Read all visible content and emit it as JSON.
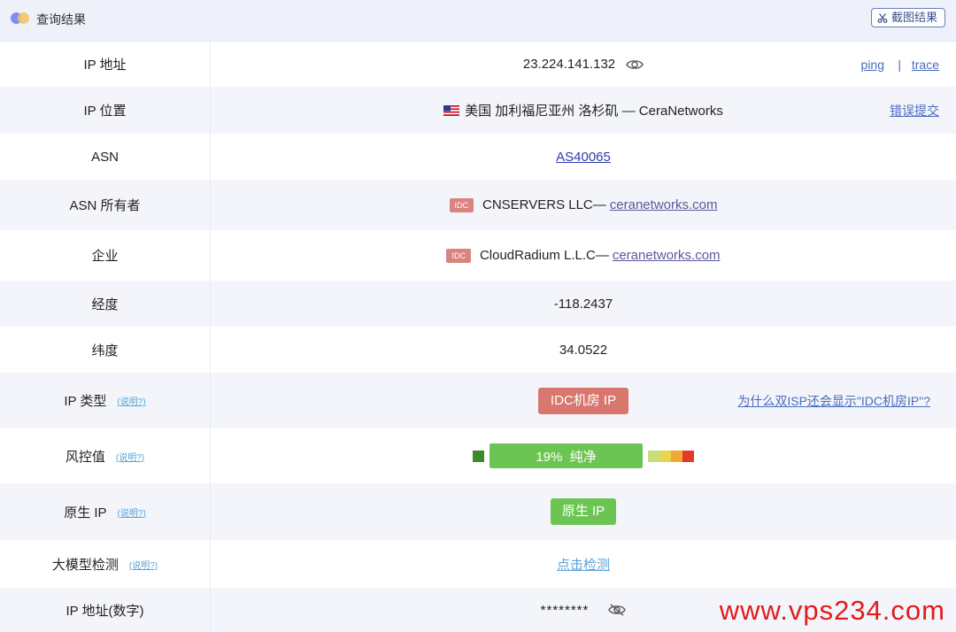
{
  "header": {
    "title": "查询结果",
    "screenshot_label": "截图结果"
  },
  "rows": {
    "ip": {
      "label": "IP 地址",
      "value": "23.224.141.132",
      "ping": "ping",
      "sep": "|",
      "trace": "trace"
    },
    "location": {
      "label": "IP 位置",
      "flag": "🇺🇸",
      "value": "美国 加利福尼亚州 洛杉矶 — CeraNetworks",
      "report": "错误提交"
    },
    "asn": {
      "label": "ASN",
      "value": "AS40065"
    },
    "asn_owner": {
      "label": "ASN 所有者",
      "badge": "IDC",
      "name": "CNSERVERS LLC—",
      "domain": "ceranetworks.com"
    },
    "company": {
      "label": "企业",
      "badge": "IDC",
      "name": "CloudRadium L.L.C—",
      "domain": "ceranetworks.com"
    },
    "longitude": {
      "label": "经度",
      "value": "-118.2437"
    },
    "latitude": {
      "label": "纬度",
      "value": "34.0522"
    },
    "ip_type": {
      "label": "IP 类型",
      "help": "(说明?)",
      "tag": "IDC机房 IP",
      "why": "为什么双ISP还会显示\"IDC机房IP\"?"
    },
    "risk": {
      "label": "风控值",
      "help": "(说明?)",
      "score_text": "19%  纯净",
      "score_percent": 19,
      "scale_colors": [
        "#c6df7a",
        "#e8d54e",
        "#eeaa35",
        "#e23a2a"
      ]
    },
    "native_ip": {
      "label": "原生 IP",
      "help": "(说明?)",
      "tag": "原生 IP"
    },
    "llm": {
      "label": "大模型检测",
      "help": "(说明?)",
      "link": "点击检测"
    },
    "ip_numeric": {
      "label": "IP 地址(数字)",
      "value": "********"
    }
  },
  "watermark": "www.vps234.com",
  "colors": {
    "accent": "#4a6cc0",
    "idc": "#d9776f",
    "clean": "#6cc553",
    "watermark": "#e21b1b"
  }
}
